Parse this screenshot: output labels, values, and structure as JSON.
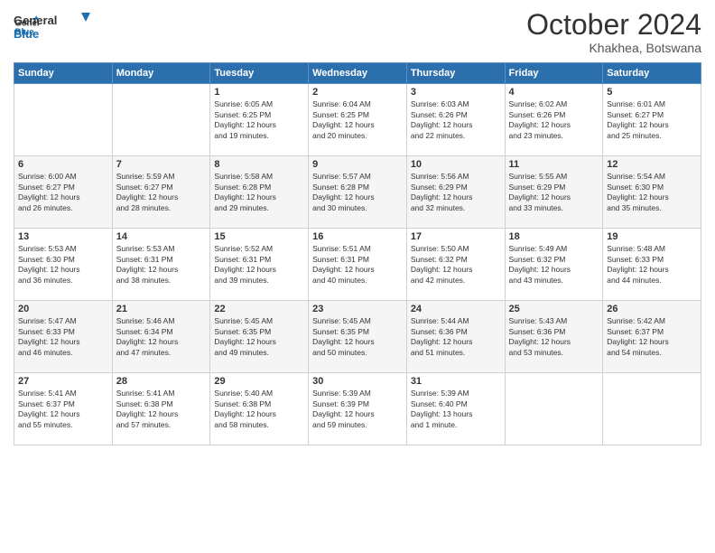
{
  "header": {
    "logo_line1": "General",
    "logo_line2": "Blue",
    "month": "October 2024",
    "location": "Khakhea, Botswana"
  },
  "weekdays": [
    "Sunday",
    "Monday",
    "Tuesday",
    "Wednesday",
    "Thursday",
    "Friday",
    "Saturday"
  ],
  "weeks": [
    [
      {
        "day": "",
        "info": ""
      },
      {
        "day": "",
        "info": ""
      },
      {
        "day": "1",
        "info": "Sunrise: 6:05 AM\nSunset: 6:25 PM\nDaylight: 12 hours\nand 19 minutes."
      },
      {
        "day": "2",
        "info": "Sunrise: 6:04 AM\nSunset: 6:25 PM\nDaylight: 12 hours\nand 20 minutes."
      },
      {
        "day": "3",
        "info": "Sunrise: 6:03 AM\nSunset: 6:26 PM\nDaylight: 12 hours\nand 22 minutes."
      },
      {
        "day": "4",
        "info": "Sunrise: 6:02 AM\nSunset: 6:26 PM\nDaylight: 12 hours\nand 23 minutes."
      },
      {
        "day": "5",
        "info": "Sunrise: 6:01 AM\nSunset: 6:27 PM\nDaylight: 12 hours\nand 25 minutes."
      }
    ],
    [
      {
        "day": "6",
        "info": "Sunrise: 6:00 AM\nSunset: 6:27 PM\nDaylight: 12 hours\nand 26 minutes."
      },
      {
        "day": "7",
        "info": "Sunrise: 5:59 AM\nSunset: 6:27 PM\nDaylight: 12 hours\nand 28 minutes."
      },
      {
        "day": "8",
        "info": "Sunrise: 5:58 AM\nSunset: 6:28 PM\nDaylight: 12 hours\nand 29 minutes."
      },
      {
        "day": "9",
        "info": "Sunrise: 5:57 AM\nSunset: 6:28 PM\nDaylight: 12 hours\nand 30 minutes."
      },
      {
        "day": "10",
        "info": "Sunrise: 5:56 AM\nSunset: 6:29 PM\nDaylight: 12 hours\nand 32 minutes."
      },
      {
        "day": "11",
        "info": "Sunrise: 5:55 AM\nSunset: 6:29 PM\nDaylight: 12 hours\nand 33 minutes."
      },
      {
        "day": "12",
        "info": "Sunrise: 5:54 AM\nSunset: 6:30 PM\nDaylight: 12 hours\nand 35 minutes."
      }
    ],
    [
      {
        "day": "13",
        "info": "Sunrise: 5:53 AM\nSunset: 6:30 PM\nDaylight: 12 hours\nand 36 minutes."
      },
      {
        "day": "14",
        "info": "Sunrise: 5:53 AM\nSunset: 6:31 PM\nDaylight: 12 hours\nand 38 minutes."
      },
      {
        "day": "15",
        "info": "Sunrise: 5:52 AM\nSunset: 6:31 PM\nDaylight: 12 hours\nand 39 minutes."
      },
      {
        "day": "16",
        "info": "Sunrise: 5:51 AM\nSunset: 6:31 PM\nDaylight: 12 hours\nand 40 minutes."
      },
      {
        "day": "17",
        "info": "Sunrise: 5:50 AM\nSunset: 6:32 PM\nDaylight: 12 hours\nand 42 minutes."
      },
      {
        "day": "18",
        "info": "Sunrise: 5:49 AM\nSunset: 6:32 PM\nDaylight: 12 hours\nand 43 minutes."
      },
      {
        "day": "19",
        "info": "Sunrise: 5:48 AM\nSunset: 6:33 PM\nDaylight: 12 hours\nand 44 minutes."
      }
    ],
    [
      {
        "day": "20",
        "info": "Sunrise: 5:47 AM\nSunset: 6:33 PM\nDaylight: 12 hours\nand 46 minutes."
      },
      {
        "day": "21",
        "info": "Sunrise: 5:46 AM\nSunset: 6:34 PM\nDaylight: 12 hours\nand 47 minutes."
      },
      {
        "day": "22",
        "info": "Sunrise: 5:45 AM\nSunset: 6:35 PM\nDaylight: 12 hours\nand 49 minutes."
      },
      {
        "day": "23",
        "info": "Sunrise: 5:45 AM\nSunset: 6:35 PM\nDaylight: 12 hours\nand 50 minutes."
      },
      {
        "day": "24",
        "info": "Sunrise: 5:44 AM\nSunset: 6:36 PM\nDaylight: 12 hours\nand 51 minutes."
      },
      {
        "day": "25",
        "info": "Sunrise: 5:43 AM\nSunset: 6:36 PM\nDaylight: 12 hours\nand 53 minutes."
      },
      {
        "day": "26",
        "info": "Sunrise: 5:42 AM\nSunset: 6:37 PM\nDaylight: 12 hours\nand 54 minutes."
      }
    ],
    [
      {
        "day": "27",
        "info": "Sunrise: 5:41 AM\nSunset: 6:37 PM\nDaylight: 12 hours\nand 55 minutes."
      },
      {
        "day": "28",
        "info": "Sunrise: 5:41 AM\nSunset: 6:38 PM\nDaylight: 12 hours\nand 57 minutes."
      },
      {
        "day": "29",
        "info": "Sunrise: 5:40 AM\nSunset: 6:38 PM\nDaylight: 12 hours\nand 58 minutes."
      },
      {
        "day": "30",
        "info": "Sunrise: 5:39 AM\nSunset: 6:39 PM\nDaylight: 12 hours\nand 59 minutes."
      },
      {
        "day": "31",
        "info": "Sunrise: 5:39 AM\nSunset: 6:40 PM\nDaylight: 13 hours\nand 1 minute."
      },
      {
        "day": "",
        "info": ""
      },
      {
        "day": "",
        "info": ""
      }
    ]
  ]
}
